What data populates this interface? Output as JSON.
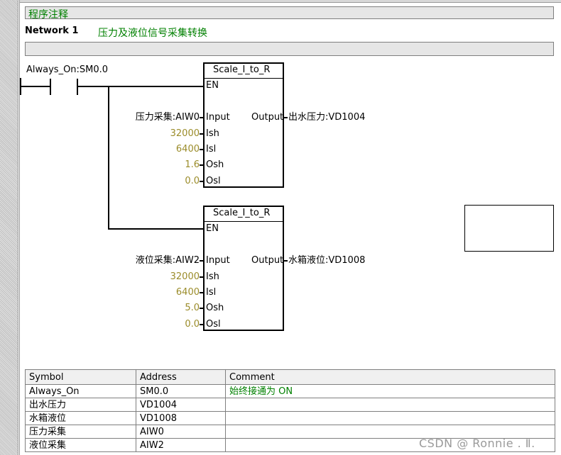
{
  "program_comment": "程序注释",
  "network": {
    "label": "Network 1",
    "title": "压力及液位信号采集转换"
  },
  "contact": {
    "label": "Always_On:SM0.0"
  },
  "blocks": [
    {
      "name": "Scale_I_to_R",
      "en": "EN",
      "input_label": "Input",
      "output_label": "Output",
      "input_operand": "压力采集:AIW0",
      "output_operand": "出水压力:VD1004",
      "params": [
        {
          "pin": "Ish",
          "value": "32000"
        },
        {
          "pin": "Isl",
          "value": "6400"
        },
        {
          "pin": "Osh",
          "value": "1.6"
        },
        {
          "pin": "Osl",
          "value": "0.0"
        }
      ]
    },
    {
      "name": "Scale_I_to_R",
      "en": "EN",
      "input_label": "Input",
      "output_label": "Output",
      "input_operand": "液位采集:AIW2",
      "output_operand": "水箱液位:VD1008",
      "params": [
        {
          "pin": "Ish",
          "value": "32000"
        },
        {
          "pin": "Isl",
          "value": "6400"
        },
        {
          "pin": "Osh",
          "value": "5.0"
        },
        {
          "pin": "Osl",
          "value": "0.0"
        }
      ]
    }
  ],
  "symbol_table": {
    "headers": [
      "Symbol",
      "Address",
      "Comment"
    ],
    "rows": [
      {
        "symbol": "Always_On",
        "address": "SM0.0",
        "comment": "始终接通为 ON"
      },
      {
        "symbol": "出水压力",
        "address": "VD1004",
        "comment": ""
      },
      {
        "symbol": "水箱液位",
        "address": "VD1008",
        "comment": ""
      },
      {
        "symbol": "压力采集",
        "address": "AIW0",
        "comment": ""
      },
      {
        "symbol": "液位采集",
        "address": "AIW2",
        "comment": ""
      }
    ]
  },
  "watermark": "CSDN @    Ronnie . Ⅱ.",
  "colors": {
    "comment_green": "#008000",
    "constant_olive": "#9b8c2a",
    "rung_line": "#000000"
  }
}
